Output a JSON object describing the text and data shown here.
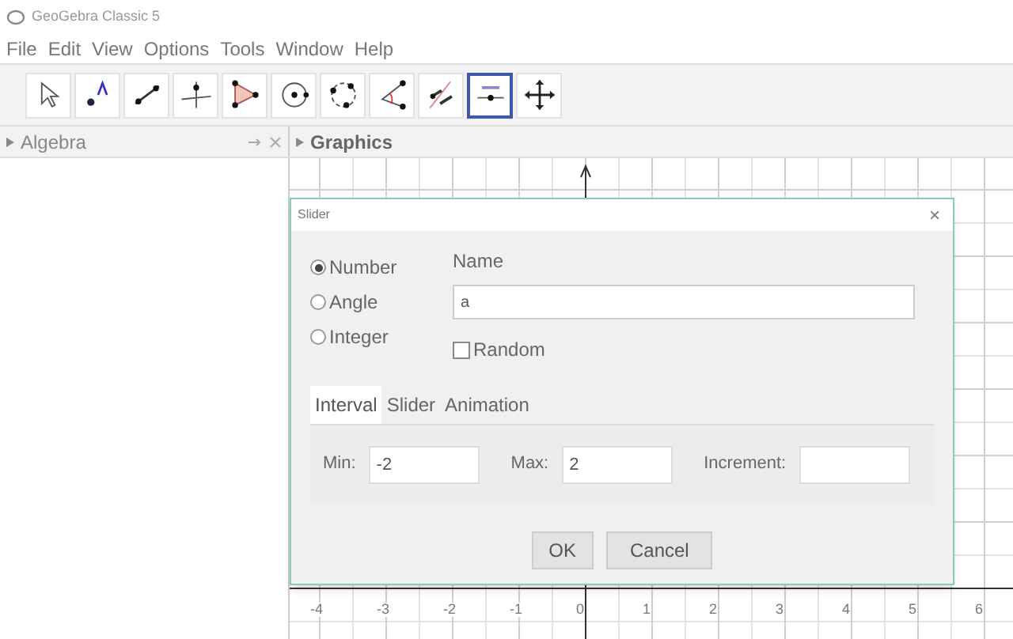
{
  "window": {
    "title": "GeoGebra Classic 5"
  },
  "menu": [
    "File",
    "Edit",
    "View",
    "Options",
    "Tools",
    "Window",
    "Help"
  ],
  "toolbar": [
    {
      "kind": "move",
      "selected": false
    },
    {
      "kind": "point",
      "selected": false
    },
    {
      "kind": "line",
      "selected": false
    },
    {
      "kind": "perpendicular",
      "selected": false
    },
    {
      "kind": "polygon",
      "selected": false
    },
    {
      "kind": "circle",
      "selected": false
    },
    {
      "kind": "circle3",
      "selected": false
    },
    {
      "kind": "angle",
      "selected": false
    },
    {
      "kind": "reflect",
      "selected": false
    },
    {
      "kind": "slider",
      "selected": true
    },
    {
      "kind": "pan",
      "selected": false
    }
  ],
  "panels": [
    {
      "title": "Algebra"
    },
    {
      "title": "Graphics"
    }
  ],
  "graphics": {
    "x_axis_labels": [
      "-4",
      "-3",
      "-2",
      "-1",
      "0",
      "1",
      "2",
      "3",
      "4",
      "5",
      "6"
    ]
  },
  "dialog": {
    "title": "Slider",
    "close": "×",
    "types": [
      {
        "label": "Number",
        "selected": true
      },
      {
        "label": "Angle",
        "selected": false
      },
      {
        "label": "Integer",
        "selected": false
      }
    ],
    "name_label": "Name",
    "name_value": "a",
    "random": {
      "label": "Random",
      "checked": false
    },
    "tabs": [
      {
        "label": "Interval",
        "selected": true
      },
      {
        "label": "Slider",
        "selected": false
      },
      {
        "label": "Animation",
        "selected": false
      }
    ],
    "fields": [
      {
        "label": "Min:",
        "value": "-2"
      },
      {
        "label": "Max:",
        "value": "2"
      },
      {
        "label": "Increment:"
      }
    ],
    "buttons": [
      "OK",
      "Cancel"
    ]
  }
}
